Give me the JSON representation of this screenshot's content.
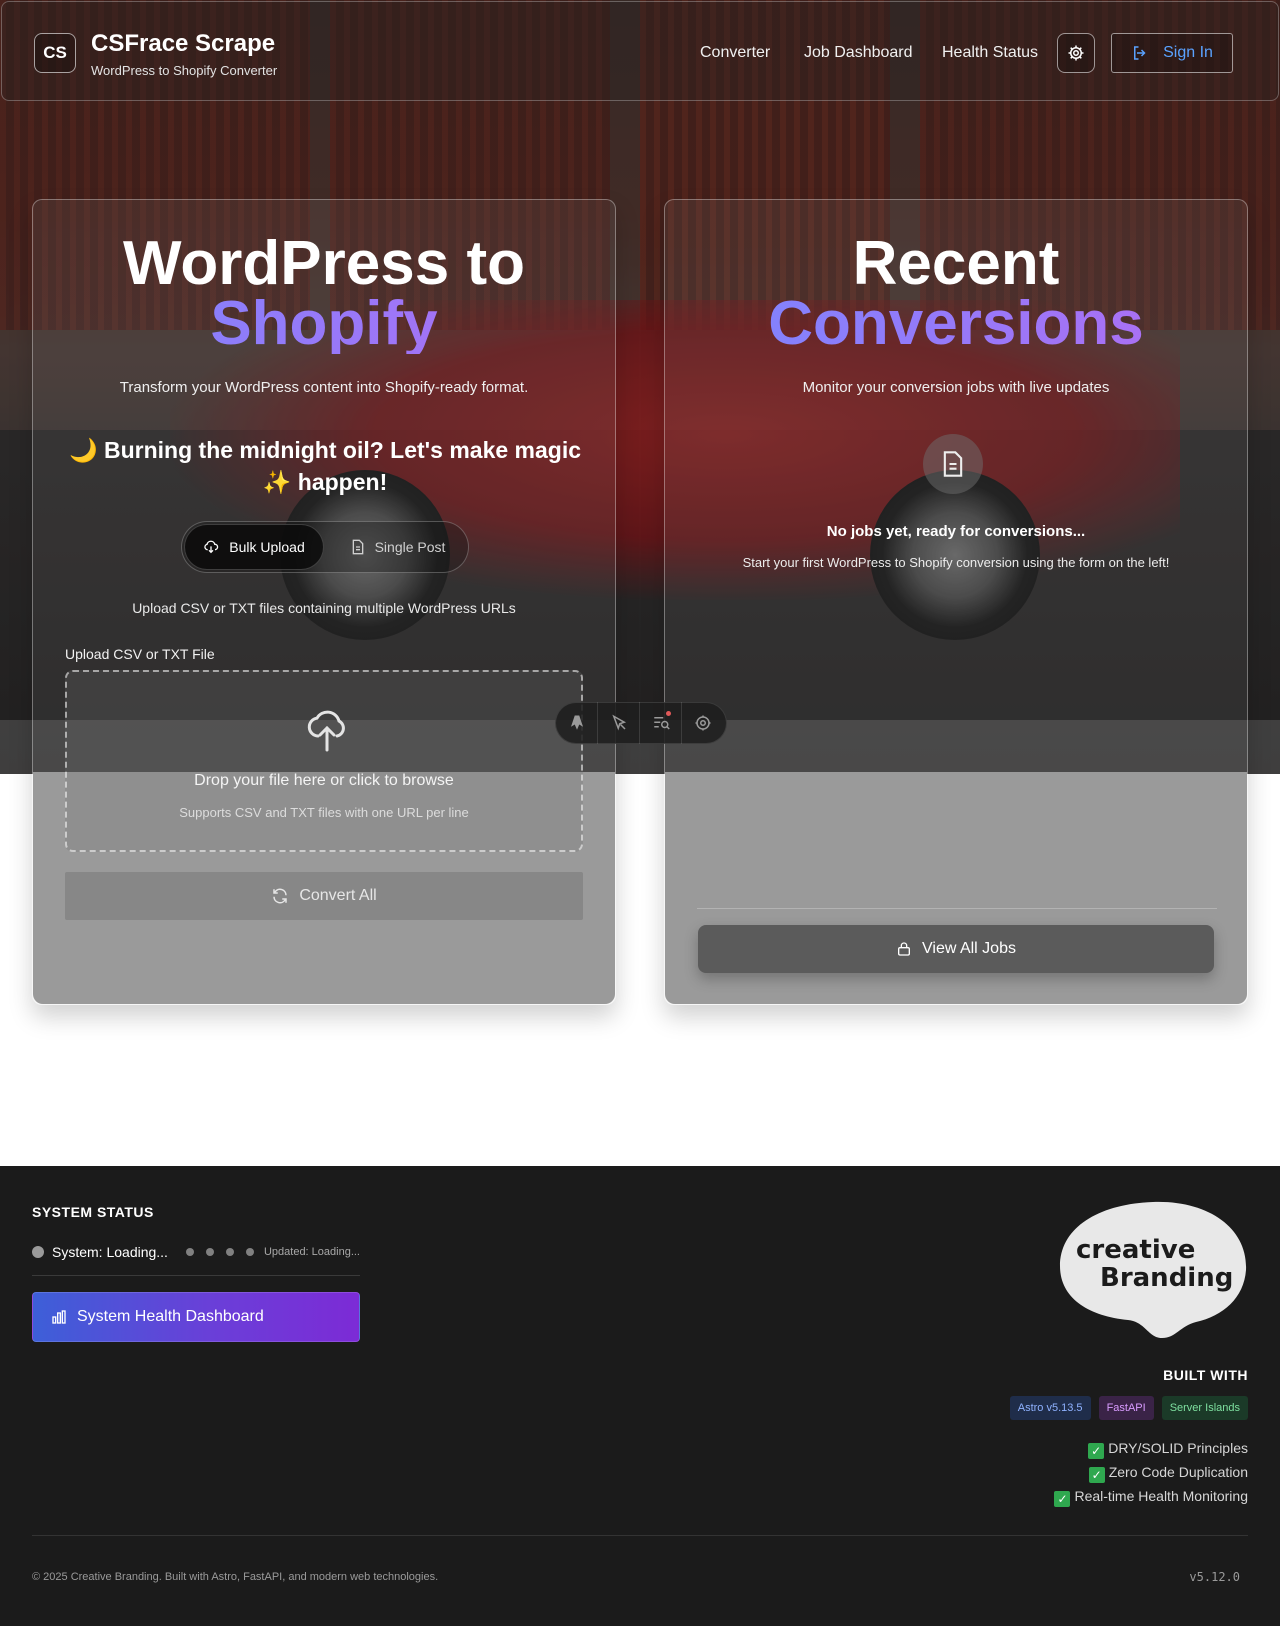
{
  "header": {
    "logo_initials": "CS",
    "title": "CSFrace Scrape",
    "subtitle": "WordPress to Shopify Converter",
    "nav": [
      "Converter",
      "Job Dashboard",
      "Health Status"
    ],
    "signin_label": "Sign In"
  },
  "converter": {
    "title_line1": "WordPress to",
    "title_line2": "Shopify",
    "description": "Transform your WordPress content into Shopify-ready format.",
    "greeting": "🌙 Burning the midnight oil? Let's make magic ✨ happen!",
    "mode_bulk": "Bulk Upload",
    "mode_single": "Single Post",
    "mode_hint": "Upload CSV or TXT files containing multiple WordPress URLs",
    "upload_label": "Upload CSV or TXT File",
    "dropzone_main": "Drop your file here or click to browse",
    "dropzone_sub": "Supports CSV and TXT files with one URL per line",
    "convert_label": "Convert All"
  },
  "recent": {
    "title_line1": "Recent",
    "title_line2": "Conversions",
    "description": "Monitor your conversion jobs with live updates",
    "empty_title": "No jobs yet, ready for conversions...",
    "empty_sub": "Start your first WordPress to Shopify conversion using the form on the left!",
    "view_all_label": "View All Jobs"
  },
  "dev_toolbar": {
    "icons": [
      "astro-logo-icon",
      "inspect-icon",
      "audit-icon",
      "settings-icon"
    ]
  },
  "footer": {
    "system_status_title": "SYSTEM STATUS",
    "system_status_text": "System: Loading...",
    "updated_text": "Updated: Loading...",
    "health_button_label": "System Health Dashboard",
    "brand_logo_line1": "creative",
    "brand_logo_line2": "Branding",
    "built_with_title": "BUILT WITH",
    "badges": [
      "Astro v5.13.5",
      "FastAPI",
      "Server Islands"
    ],
    "checks": [
      "DRY/SOLID Principles",
      "Zero Code Duplication",
      "Real-time Health Monitoring"
    ],
    "copyright": "© 2025 Creative Branding. Built with Astro, FastAPI, and modern web technologies.",
    "version": "v5.12.0"
  },
  "colors": {
    "accent_gradient_start": "#7a86ff",
    "accent_gradient_end": "#b36cf2",
    "signin_blue": "#5aa2ff",
    "footer_bg": "#1b1b1b"
  }
}
